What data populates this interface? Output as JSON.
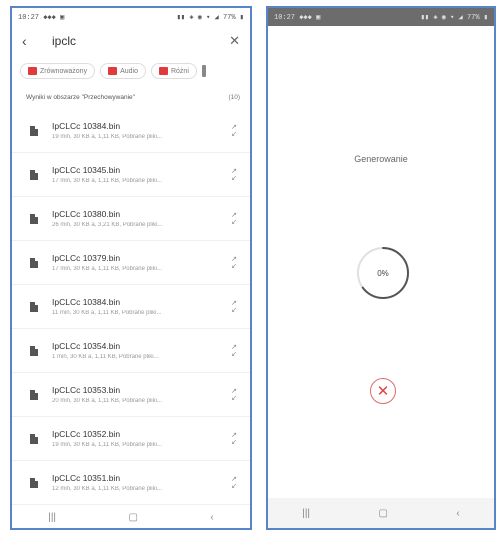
{
  "left": {
    "status": {
      "left": "10:27 ◆◆◆ ▣",
      "right": "▮▮ ◈ ◉ ▾ ◢ 77% ▮"
    },
    "search": {
      "query": "ipclc"
    },
    "chips": [
      {
        "label": "Zrównoważony"
      },
      {
        "label": "Audio"
      },
      {
        "label": "Różni"
      }
    ],
    "results_header": {
      "label": "Wyniki w obszarze \"Przechowywanie\"",
      "count": "(10)"
    },
    "files": [
      {
        "name": "IpCLCc 10384.bin",
        "meta": "19 min, 30 KB a, 1,11 KB, Pobrane pliki..."
      },
      {
        "name": "IpCLCc 10345.bin",
        "meta": "17 min, 30 KB a, 1,11 KB, Pobrane pliki..."
      },
      {
        "name": "IpCLCc 10380.bin",
        "meta": "26 min, 30 KB a, 3,21 KB, Pobrane pliki..."
      },
      {
        "name": "IpCLCc 10379.bin",
        "meta": "17 min, 30 KB a, 1,11 KB, Pobrane pliki..."
      },
      {
        "name": "IpCLCc 10384.bin",
        "meta": "11 min, 30 KB a, 1,11 KB, Pobrane pliki..."
      },
      {
        "name": "IpCLCc 10354.bin",
        "meta": "1 min, 30 KB a, 1,11 KB, Pobrane pliki..."
      },
      {
        "name": "IpCLCc 10353.bin",
        "meta": "20 min, 30 KB a, 1,11 KB, Pobrane pliki..."
      },
      {
        "name": "IpCLCc 10352.bin",
        "meta": "19 min, 30 KB a, 1,11 KB, Pobrane pliki..."
      },
      {
        "name": "IpCLCc 10351.bin",
        "meta": "12 min, 30 KB a, 1,11 KB, Pobrane pliki..."
      }
    ],
    "nav": {
      "recents": "|||",
      "home": "▢",
      "back": "‹"
    }
  },
  "right": {
    "status": {
      "left": "10:27 ◆◆◆ ▣",
      "right": "▮▮ ◈ ◉ ▾ ◢ 77% ▮"
    },
    "generating_text": "Generowanie",
    "progress": {
      "label": "0%",
      "value": 0.65
    },
    "nav": {
      "recents": "|||",
      "home": "▢",
      "back": "‹"
    },
    "colors": {
      "accent": "#e04545",
      "ring": "#555555",
      "ring_track": "#e0e0e0"
    }
  }
}
